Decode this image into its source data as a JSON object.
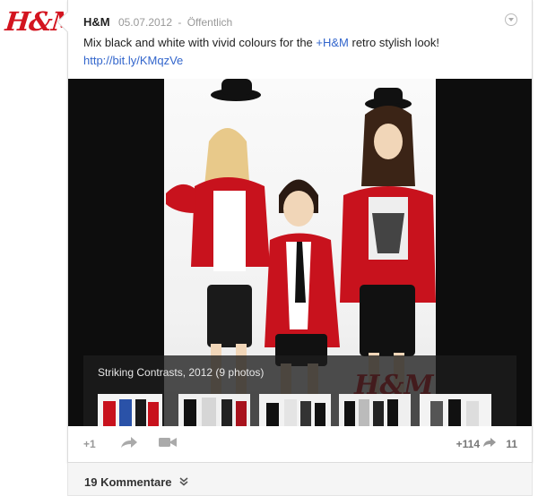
{
  "logo": {
    "text": "H&M",
    "brand_color": "#d3141f"
  },
  "post": {
    "author": "H&M",
    "date": "05.07.2012",
    "separator": "-",
    "visibility": "Öffentlich",
    "text_before": "Mix black and white with vivid colours for the ",
    "mention": "+H&M",
    "text_after": " retro stylish look! ",
    "link": "http://bit.ly/KMqzVe",
    "link_color": "#3366cc",
    "menu_icon": "chevron-down-icon"
  },
  "media": {
    "photo_description_icon": "fashion-photo",
    "album_title": "Striking Contrasts, 2012 (9 photos)",
    "thumbnail_count": 5
  },
  "actions": {
    "plus_one_label": "+1",
    "share_icon": "share-icon",
    "video_icon": "video-camera-icon",
    "plus_count": "+114",
    "reshare_icon": "reshare-icon",
    "reshare_count": "11"
  },
  "comments": {
    "label": "19 Kommentare",
    "expand_icon": "double-chevron-down-icon"
  }
}
